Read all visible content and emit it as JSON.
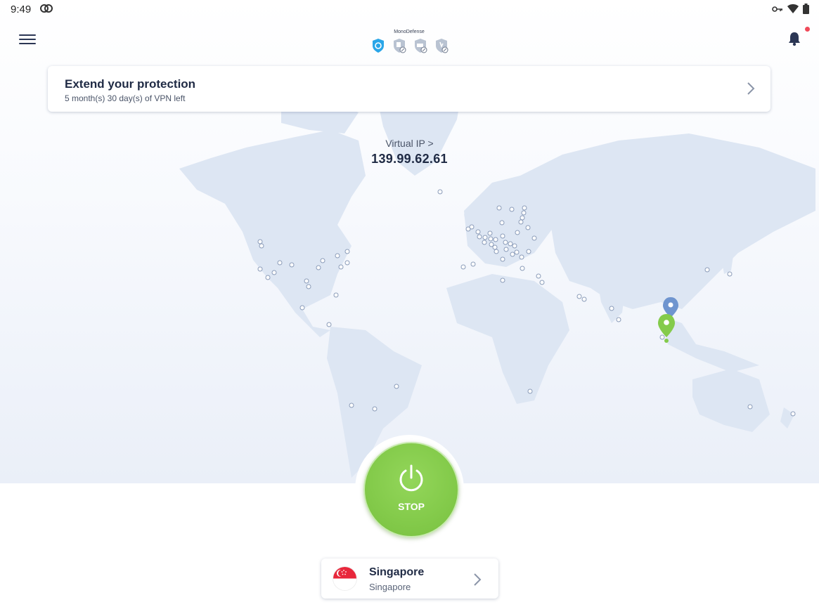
{
  "status_bar": {
    "time": "9:49",
    "icons": [
      "app-icon",
      "vpn-key-icon",
      "wifi-icon",
      "battery-icon"
    ]
  },
  "header": {
    "menu_icon": "hamburger-menu-icon",
    "brand_title": "MonoDefense",
    "brand_icons": [
      "vpn-shield-icon",
      "shield-doc-icon",
      "shield-id-icon",
      "shield-antivirus-icon"
    ],
    "notification_icon": "bell-icon",
    "accent": "#2aa6e8",
    "badge_color": "#f04a5a"
  },
  "promo": {
    "title": "Extend your protection",
    "subtitle": "5 month(s) 30 day(s) of VPN left"
  },
  "virtual_ip": {
    "label": "Virtual IP >",
    "value": "139.99.62.61"
  },
  "connection": {
    "button_label": "STOP",
    "button_color": "#84cb4b"
  },
  "location": {
    "country": "Singapore",
    "city": "Singapore",
    "flag_icon": "singapore-flag-icon"
  }
}
